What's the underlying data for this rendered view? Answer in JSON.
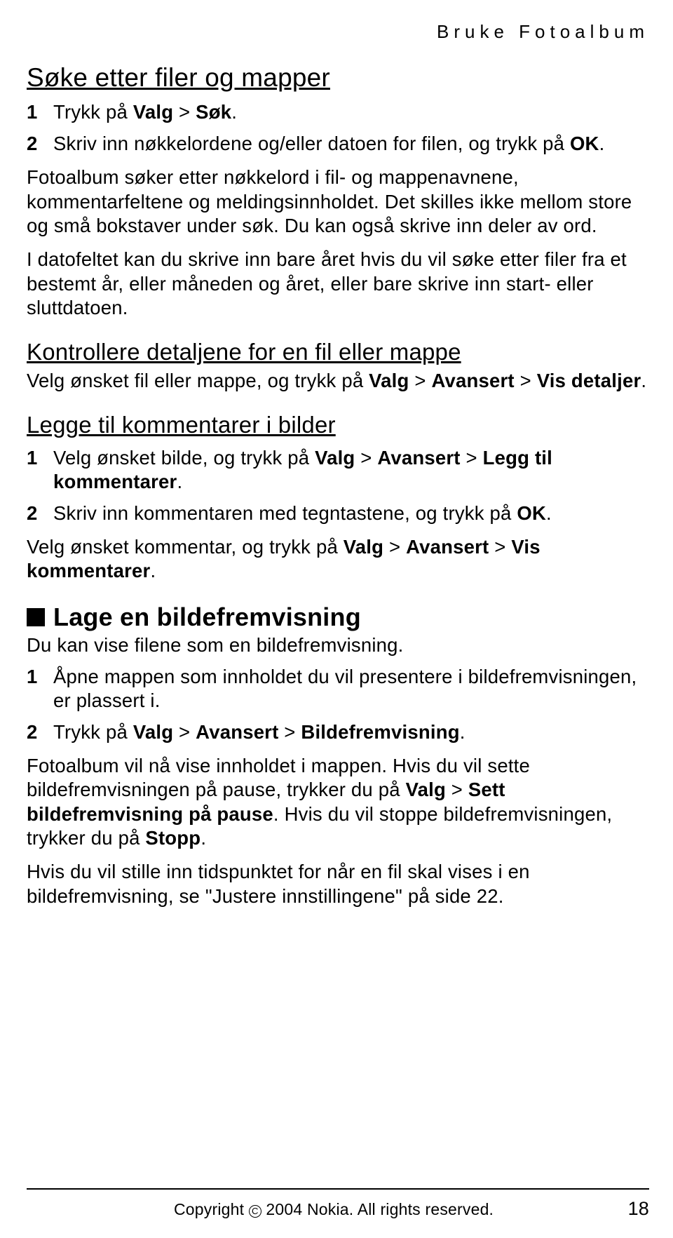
{
  "runhead": "Bruke Fotoalbum",
  "section1": {
    "title": "Søke etter filer og mapper",
    "steps": [
      {
        "num": "1",
        "pre": "Trykk på ",
        "b1": "Valg",
        "mid": " > ",
        "b2": "Søk",
        "post": "."
      },
      {
        "num": "2",
        "pre": "Skriv inn nøkkelordene og/eller datoen for filen, og trykk på ",
        "b1": "OK",
        "post": "."
      }
    ],
    "para1": "Fotoalbum søker etter nøkkelord i fil- og mappenavnene, kommentarfeltene og meldingsinnholdet. Det skilles ikke mellom store og små bokstaver under søk. Du kan også skrive inn deler av ord.",
    "para2": "I datofeltet kan du skrive inn bare året hvis du vil søke etter filer fra et bestemt år, eller måneden og året, eller bare skrive inn start- eller sluttdatoen."
  },
  "section2": {
    "title": "Kontrollere detaljene for en fil eller mappe",
    "line_pre": "Velg ønsket fil eller mappe, og trykk på ",
    "b1": "Valg",
    "gt1": " > ",
    "b2": "Avansert",
    "gt2": " > ",
    "b3": "Vis detaljer",
    "post": "."
  },
  "section3": {
    "title": "Legge til kommentarer i bilder",
    "step1": {
      "num": "1",
      "pre": "Velg ønsket bilde, og trykk på ",
      "b1": "Valg",
      "gt1": " > ",
      "b2": "Avansert",
      "gt2": " > ",
      "b3": "Legg til kommentarer",
      "post": "."
    },
    "step2": {
      "num": "2",
      "pre": "Skriv inn kommentaren med tegntastene, og trykk på ",
      "b1": "OK",
      "post": "."
    },
    "para_pre": "Velg ønsket kommentar, og trykk på ",
    "pb1": "Valg",
    "pgt1": " > ",
    "pb2": "Avansert",
    "pgt2": " > ",
    "pb3": "Vis kommentarer",
    "ppost": "."
  },
  "section4": {
    "title": "Lage en bildefremvisning",
    "intro": "Du kan vise filene som en bildefremvisning.",
    "step1": {
      "num": "1",
      "txt": "Åpne mappen som innholdet du vil presentere i bildefremvisningen, er plassert i."
    },
    "step2": {
      "num": "2",
      "pre": "Trykk på ",
      "b1": "Valg",
      "gt1": " > ",
      "b2": "Avansert",
      "gt2": " > ",
      "b3": "Bildefremvisning",
      "post": "."
    },
    "p3_a": "Fotoalbum vil nå vise innholdet i mappen. Hvis du vil sette bildefremvisningen på pause, trykker du på ",
    "p3_b1": "Valg",
    "p3_gt": " > ",
    "p3_b2": "Sett bildefremvisning på pause",
    "p3_c": ". Hvis du vil stoppe bildefremvisningen, trykker du på ",
    "p3_b3": "Stopp",
    "p3_post": ".",
    "p4": "Hvis du vil stille inn tidspunktet for når en fil skal vises i en bildefremvisning, se \"Justere innstillingene\" på side 22."
  },
  "footer": {
    "copyright_pre": "Copyright ",
    "copyright_sym": "©",
    "copyright_post": " 2004 Nokia. All rights reserved.",
    "page": "18"
  }
}
